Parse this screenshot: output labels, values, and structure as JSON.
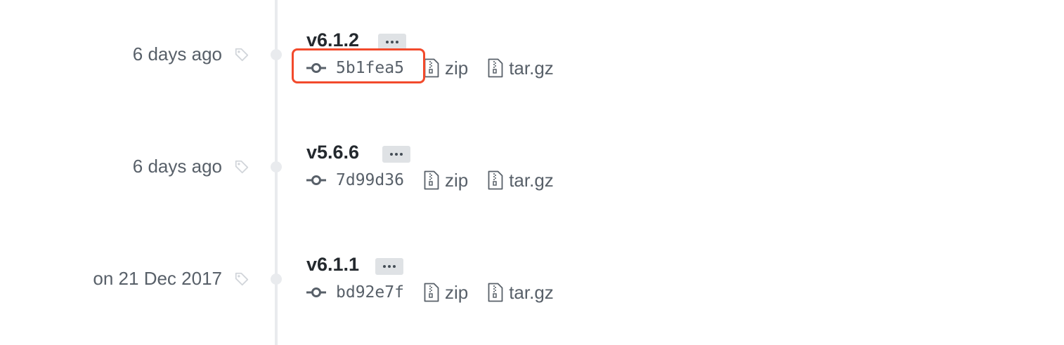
{
  "releases": [
    {
      "date": "6 days ago",
      "version": "v6.1.2",
      "sha": "5b1fea5",
      "zip_label": "zip",
      "targz_label": "tar.gz"
    },
    {
      "date": "6 days ago",
      "version": "v5.6.6",
      "sha": "7d99d36",
      "zip_label": "zip",
      "targz_label": "tar.gz"
    },
    {
      "date": "on 21 Dec 2017",
      "version": "v6.1.1",
      "sha": "bd92e7f",
      "zip_label": "zip",
      "targz_label": "tar.gz"
    }
  ],
  "icons": {
    "tag": "tag-icon",
    "commit": "git-commit-icon",
    "archive": "file-zip-icon",
    "more": "ellipsis-icon"
  },
  "colors": {
    "highlight": "#f24a2c",
    "text_muted": "#586069",
    "timeline": "#e9ebee"
  }
}
